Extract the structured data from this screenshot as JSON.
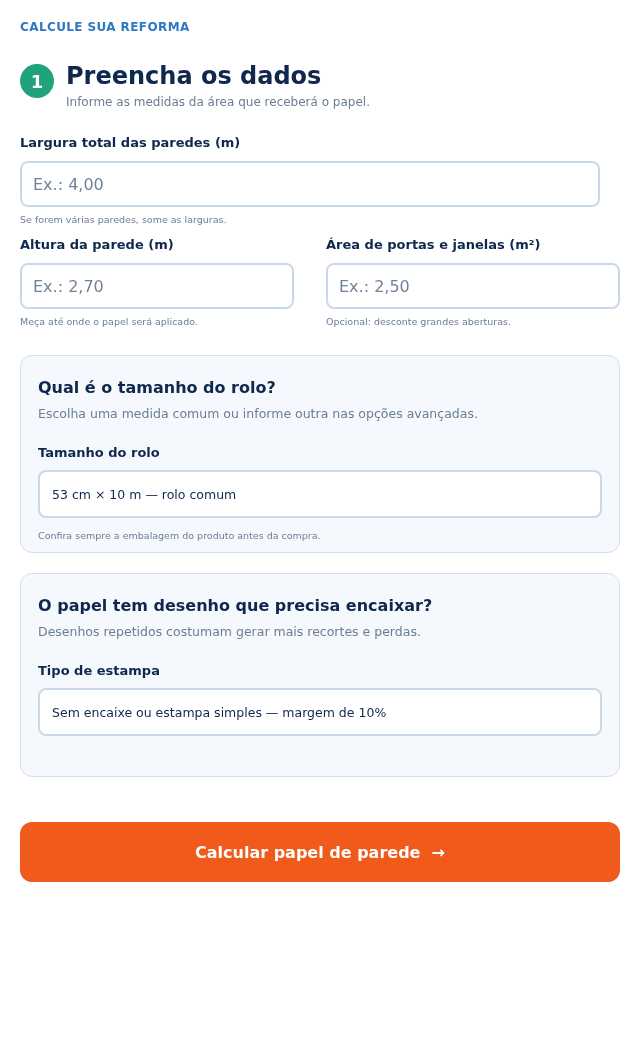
{
  "eyebrow": "CALCULE SUA REFORMA",
  "step": {
    "number": "1",
    "title": "Preencha os dados",
    "subtitle": "Informe as medidas da área que receberá o papel."
  },
  "width_field": {
    "label": "Largura total das paredes (m)",
    "placeholder": "Ex.: 4,00",
    "hint": "Se forem várias paredes, some as larguras."
  },
  "pair_fields": [
    {
      "label": "Altura da parede (m)",
      "placeholder": "Ex.: 2,70",
      "hint": "Meça até onde o papel será aplicado."
    },
    {
      "label": "Área de portas e janelas (m²)",
      "placeholder": "Ex.: 2,50",
      "hint": "Opcional: desconte grandes aberturas."
    }
  ],
  "cards": [
    {
      "title": "Qual é o tamanho do rolo?",
      "subtitle": "Escolha uma medida comum ou informe outra nas opções avançadas.",
      "label": "Tamanho do rolo",
      "value": "53 cm × 10 m — rolo comum",
      "hint": "Confira sempre a embalagem do produto antes da compra."
    },
    {
      "title": "O papel tem desenho que precisa encaixar?",
      "subtitle": "Desenhos repetidos costumam gerar mais recortes e perdas.",
      "label": "Tipo de estampa",
      "value": "Sem encaixe ou estampa simples — margem de 10%"
    }
  ],
  "submit": {
    "label": "Calcular papel de parede",
    "arrow": "→"
  }
}
